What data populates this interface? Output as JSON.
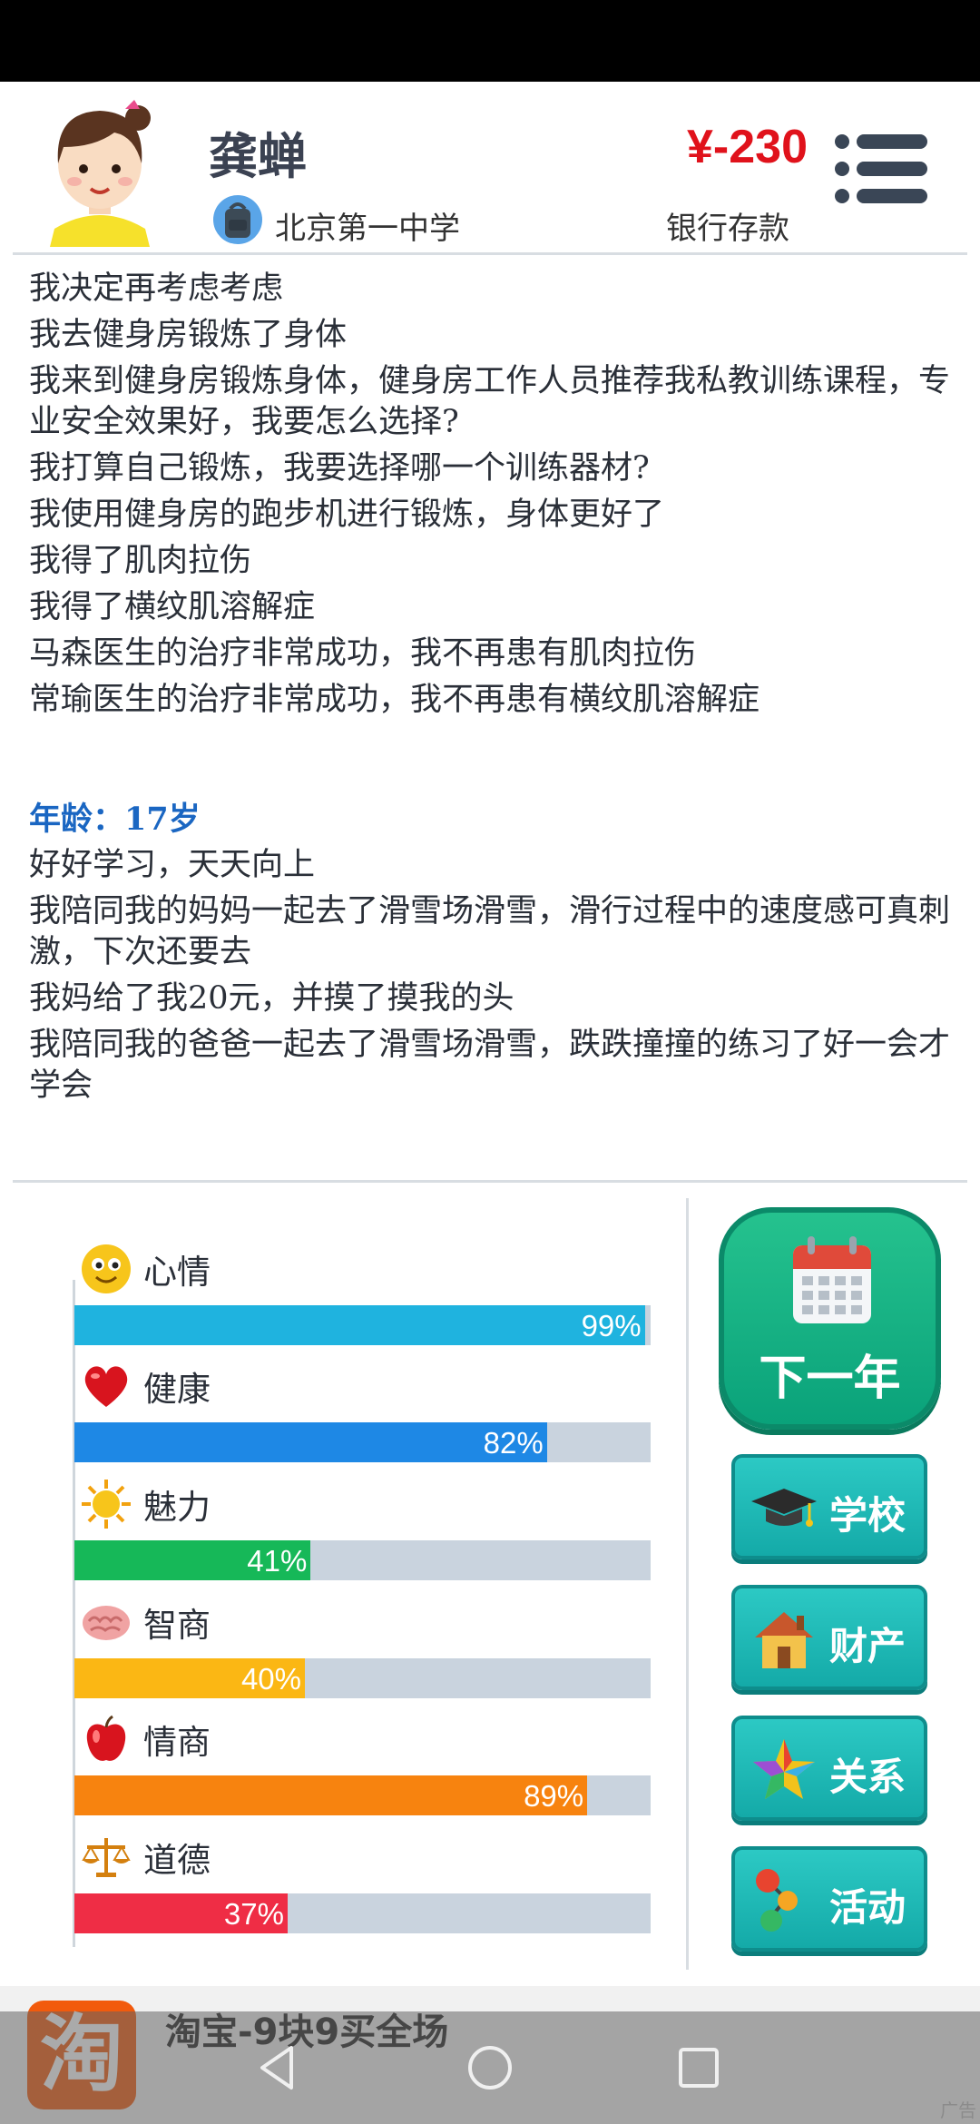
{
  "player": {
    "name": "龚蝉",
    "school": "北京第一中学",
    "money": "¥-230",
    "money_label": "银行存款"
  },
  "log": {
    "events_before": [
      "我决定再考虑考虑",
      "我去健身房锻炼了身体",
      "我来到健身房锻炼身体，健身房工作人员推荐我私教训练课程，专业安全效果好，我要怎么选择?",
      "我打算自己锻炼，我要选择哪一个训练器材?",
      "我使用健身房的跑步机进行锻炼，身体更好了",
      "我得了肌肉拉伤",
      "我得了横纹肌溶解症",
      "马森医生的治疗非常成功，我不再患有肌肉拉伤",
      "常瑜医生的治疗非常成功，我不再患有横纹肌溶解症"
    ],
    "age_label": "年龄：17岁",
    "events_after": [
      "好好学习，天天向上",
      "我陪同我的妈妈一起去了滑雪场滑雪，滑行过程中的速度感可真刺激，下次还要去",
      "我妈给了我20元，并摸了摸我的头",
      "我陪同我的爸爸一起去了滑雪场滑雪，跌跌撞撞的练习了好一会才学会"
    ]
  },
  "stats": [
    {
      "label": "心情",
      "value": 0.99,
      "pct": "99%",
      "color": "#1fb3df",
      "icon": "smiley-icon"
    },
    {
      "label": "健康",
      "value": 0.82,
      "pct": "82%",
      "color": "#1e88e5",
      "icon": "heart-icon"
    },
    {
      "label": "魅力",
      "value": 0.41,
      "pct": "41%",
      "color": "#16b858",
      "icon": "sun-icon"
    },
    {
      "label": "智商",
      "value": 0.4,
      "pct": "40%",
      "color": "#fbb714",
      "icon": "brain-icon"
    },
    {
      "label": "情商",
      "value": 0.89,
      "pct": "89%",
      "color": "#f7830f",
      "icon": "apple-icon"
    },
    {
      "label": "道德",
      "value": 0.37,
      "pct": "37%",
      "color": "#ef2d45",
      "icon": "scales-icon"
    }
  ],
  "actions": {
    "next_year": "下一年",
    "school": "学校",
    "property": "财产",
    "relations": "关系",
    "activities": "活动"
  },
  "ad": {
    "logo_char": "淘",
    "text": "淘宝-9块9买全场",
    "tag": "广告"
  }
}
